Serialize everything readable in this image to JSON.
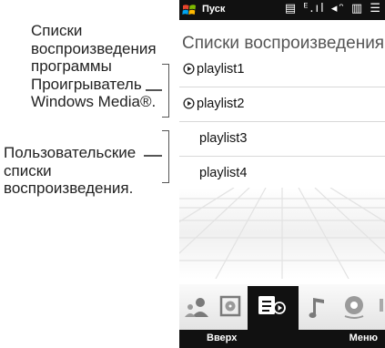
{
  "callouts": {
    "wmp_lines": [
      "Списки",
      "воспроизведения",
      "программы",
      "Проигрыватель",
      "Windows Media®."
    ],
    "user_lines": [
      "Пользовательские",
      "списки",
      "воспроизведения."
    ]
  },
  "statusbar": {
    "start_label": "Пуск",
    "icons": "▤ ᴱ.ıl ◂ᵔ ▥ ☰"
  },
  "screen": {
    "title": "Списки воспроизведения"
  },
  "playlists": [
    {
      "name": "playlist1",
      "type": "wmp"
    },
    {
      "name": "playlist2",
      "type": "wmp"
    },
    {
      "name": "playlist3",
      "type": "user"
    },
    {
      "name": "playlist4",
      "type": "user"
    }
  ],
  "tabs": [
    {
      "name": "artists-tab-icon",
      "active": false
    },
    {
      "name": "albums-tab-icon",
      "active": false
    },
    {
      "name": "playlists-tab-icon",
      "active": true
    },
    {
      "name": "music-tab-icon",
      "active": false
    },
    {
      "name": "now-playing-tab-icon",
      "active": false
    }
  ],
  "softkeys": {
    "left": "Вверх",
    "right": "Меню"
  }
}
